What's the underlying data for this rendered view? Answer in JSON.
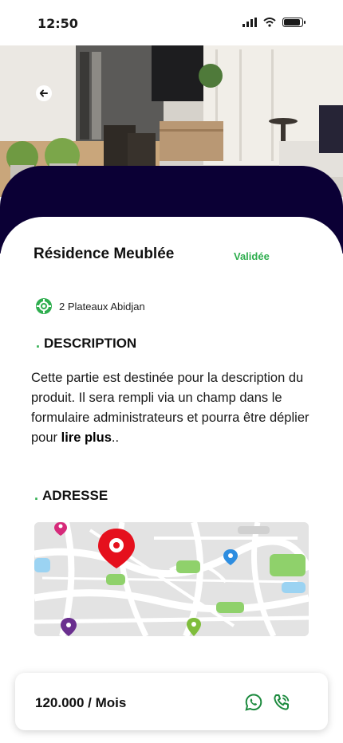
{
  "status_bar": {
    "time": "12:50"
  },
  "hero": {
    "image": "furnished-living-room-photo"
  },
  "listing": {
    "title": "Résidence Meublée",
    "status": "Validée",
    "location": "2 Plateaux Abidjan"
  },
  "description": {
    "heading": "DESCRIPTION",
    "text_part1": "Cette partie est destinée pour la description du produit. Il sera rempli via un champ dans le formulaire administrateurs et pourra être déplier pour ",
    "text_bold": "lire plus",
    "text_part2": ".."
  },
  "address": {
    "heading": "ADRESSE"
  },
  "footer": {
    "price": "120.000 / Mois"
  },
  "colors": {
    "accent": "#2fae4f",
    "navy": "#0b0035",
    "whatsapp": "#1c8a3e"
  },
  "icons": [
    "signal-icon",
    "wifi-icon",
    "battery-icon",
    "back-arrow-icon",
    "location-target-icon",
    "whatsapp-icon",
    "phone-icon",
    "map-pin-icon"
  ]
}
